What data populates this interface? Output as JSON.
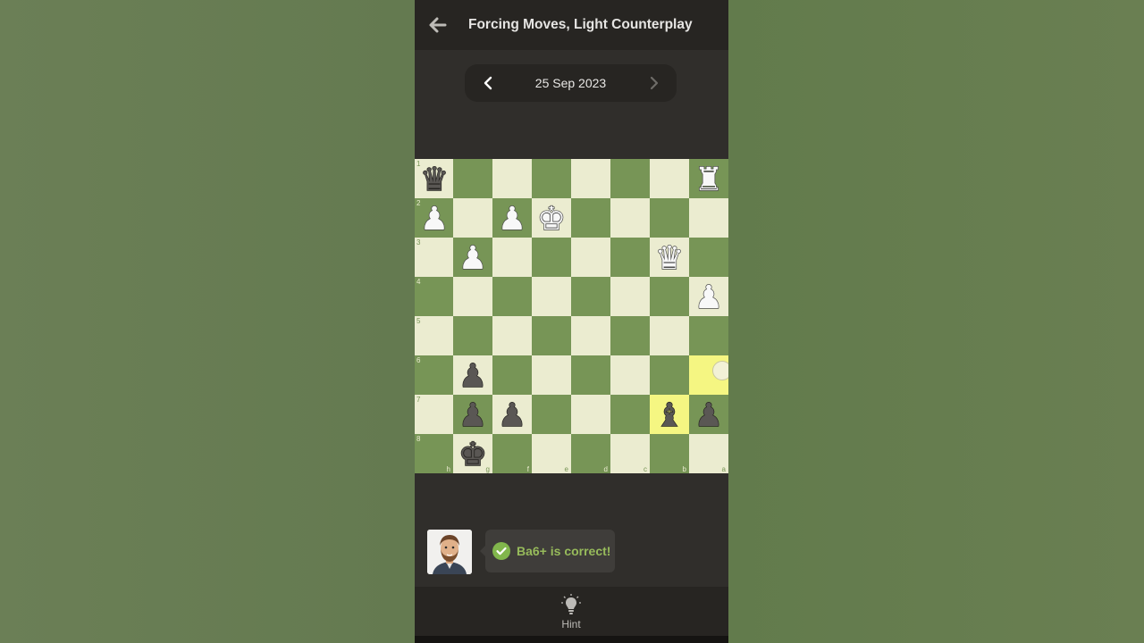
{
  "header": {
    "title": "Forcing Moves, Light Counterplay"
  },
  "date_nav": {
    "date": "25 Sep 2023"
  },
  "board": {
    "orientation": "black",
    "rank_labels": [
      "1",
      "2",
      "3",
      "4",
      "5",
      "6",
      "7",
      "8"
    ],
    "file_labels": [
      "h",
      "g",
      "f",
      "e",
      "d",
      "c",
      "b",
      "a"
    ],
    "highlighted_squares": [
      "a6",
      "b7"
    ],
    "move_target": "a6",
    "pieces": [
      {
        "square": "h1",
        "piece": "queen",
        "color": "black"
      },
      {
        "square": "a1",
        "piece": "rook",
        "color": "white"
      },
      {
        "square": "h2",
        "piece": "pawn",
        "color": "white"
      },
      {
        "square": "f2",
        "piece": "pawn",
        "color": "white"
      },
      {
        "square": "e2",
        "piece": "king",
        "color": "white"
      },
      {
        "square": "g3",
        "piece": "pawn",
        "color": "white"
      },
      {
        "square": "b3",
        "piece": "queen",
        "color": "white"
      },
      {
        "square": "a4",
        "piece": "pawn",
        "color": "white"
      },
      {
        "square": "g6",
        "piece": "pawn",
        "color": "black"
      },
      {
        "square": "g7",
        "piece": "pawn",
        "color": "black"
      },
      {
        "square": "f7",
        "piece": "pawn",
        "color": "black"
      },
      {
        "square": "b7",
        "piece": "bishop",
        "color": "black"
      },
      {
        "square": "a7",
        "piece": "pawn",
        "color": "black"
      },
      {
        "square": "g8",
        "piece": "king",
        "color": "black"
      }
    ]
  },
  "feedback": {
    "message": "Ba6+ is correct!",
    "color": "#97bb5b"
  },
  "bottom": {
    "hint_label": "Hint"
  },
  "colors": {
    "light_square": "#ebecd0",
    "dark_square": "#779556",
    "highlight_light": "#f5f682",
    "highlight_dark": "#bbcc44"
  }
}
